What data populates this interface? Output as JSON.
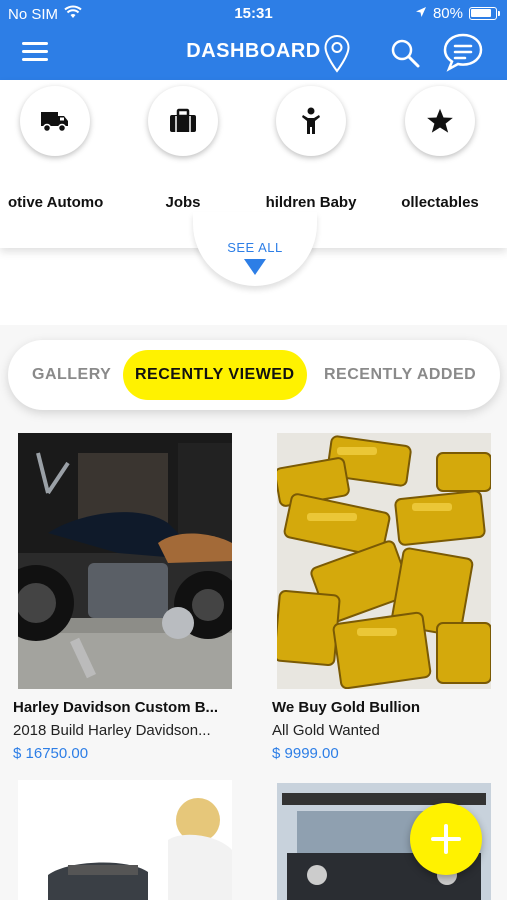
{
  "status_bar": {
    "carrier": "No SIM",
    "time": "15:31",
    "battery": "80%"
  },
  "header": {
    "title": "DASHBOARD",
    "icons": [
      "menu-icon",
      "location-pin-icon",
      "search-icon",
      "chat-icon"
    ]
  },
  "categories": [
    {
      "label": "otive Automo",
      "icon": "truck-icon"
    },
    {
      "label": "Jobs",
      "icon": "briefcase-icon"
    },
    {
      "label": "hildren Baby",
      "icon": "child-icon"
    },
    {
      "label": "ollectables",
      "icon": "star-icon"
    }
  ],
  "see_all": "SEE ALL",
  "tabs": [
    {
      "label": "GALLERY",
      "active": false
    },
    {
      "label": "RECENTLY VIEWED",
      "active": true
    },
    {
      "label": "RECENTLY ADDED",
      "active": false
    }
  ],
  "listings": [
    {
      "title": "Harley Davidson Custom B...",
      "description": "2018 Build Harley Davidson...",
      "price": "$ 16750.00"
    },
    {
      "title": "We Buy Gold Bullion",
      "description": "All Gold Wanted",
      "price": "$ 9999.00"
    }
  ],
  "colors": {
    "primary": "#2d7ee6",
    "accent": "#fff200"
  }
}
